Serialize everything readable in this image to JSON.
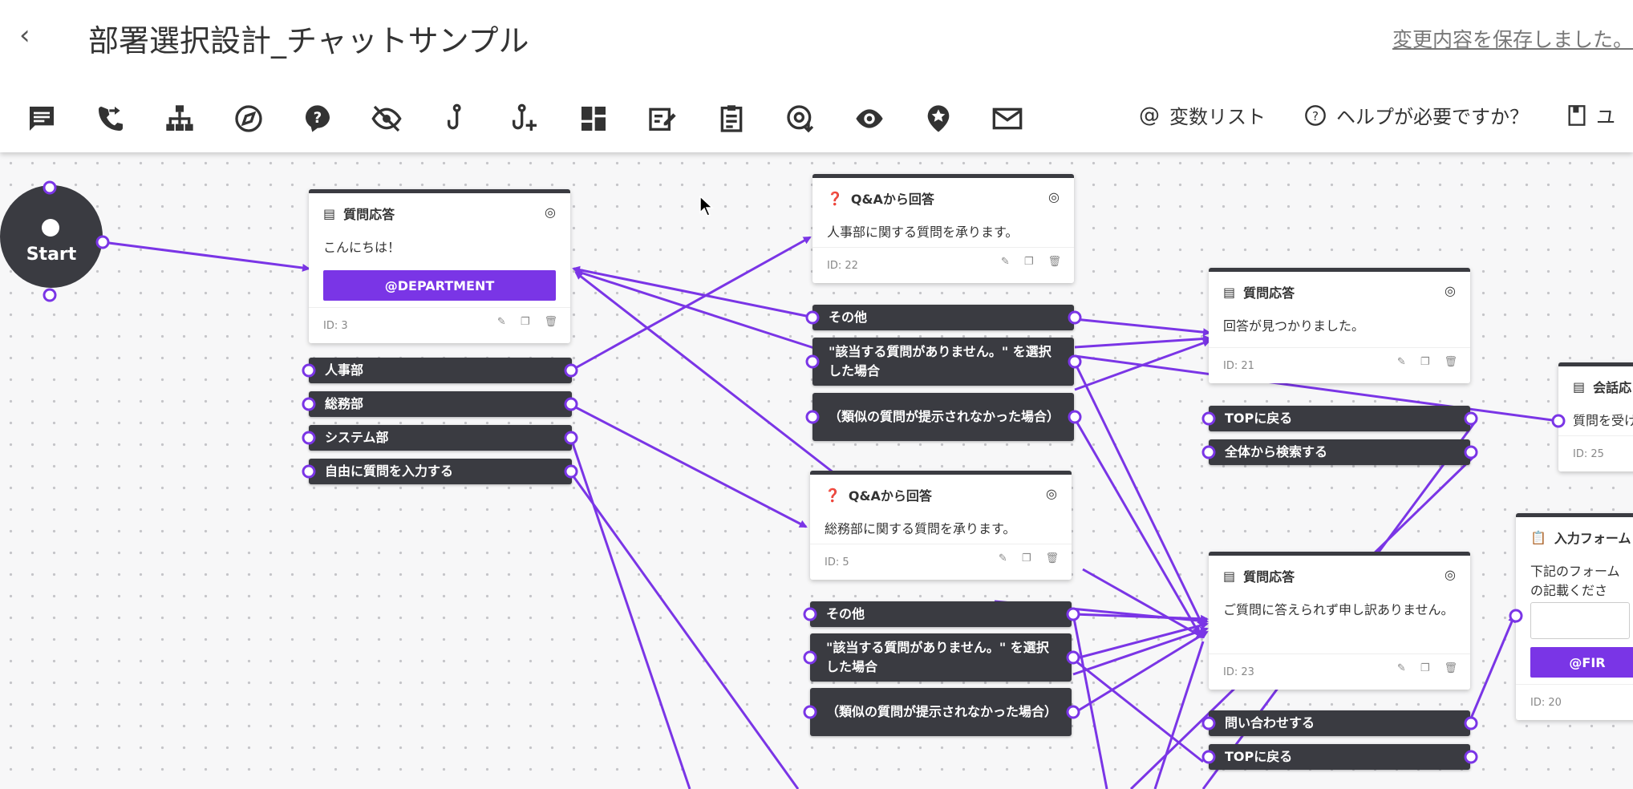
{
  "header": {
    "back_label": "‹",
    "title": "部署選択設計_チャットサンプル",
    "saved_status": "変更内容を保存しました。",
    "toolbar_icons": [
      "message-icon",
      "call-forward-icon",
      "hierarchy-icon",
      "compass-icon",
      "help-icon",
      "eye-off-icon",
      "hook-icon",
      "hook-plus-icon",
      "dashboard-icon",
      "edit-note-icon",
      "clipboard-icon",
      "at-download-icon",
      "eye-icon",
      "star-pin-icon",
      "mail-icon"
    ],
    "variables_label": "変数リスト",
    "help_label": "ヘルプが必要ですか？",
    "user_label": "ユ"
  },
  "flow": {
    "start_label": "Start",
    "card1": {
      "type": "質問応答",
      "message": "こんにちは！",
      "button": "@DEPARTMENT",
      "id": "ID: 3",
      "options": [
        "人事部",
        "総務部",
        "システム部",
        "自由に質問を入力する"
      ]
    },
    "card2": {
      "type": "Q&Aから回答",
      "message": "人事部に関する質問を承ります。",
      "id": "ID: 22",
      "options": [
        "その他",
        "\"該当する質問がありません。\" を選択した場合",
        "（類似の質問が提示されなかった場合）"
      ]
    },
    "card3": {
      "type": "Q&Aから回答",
      "message": "総務部に関する質問を承ります。",
      "id": "ID: 5",
      "options": [
        "その他",
        "\"該当する質問がありません。\" を選択した場合",
        "（類似の質問が提示されなかった場合）"
      ]
    },
    "card4": {
      "type": "質問応答",
      "message": "回答が見つかりました。",
      "id": "ID: 21",
      "options": [
        "TOPに戻る",
        "全体から検索する"
      ]
    },
    "card5": {
      "type": "質問応答",
      "message": "ご質問に答えられず申し訳ありません。",
      "id": "ID: 23",
      "options": [
        "問い合わせする",
        "TOPに戻る"
      ]
    },
    "card6": {
      "type": "会話応",
      "message": "質問を受け",
      "id": "ID: 25"
    },
    "card7": {
      "type": "入力フォーム",
      "message": "下記のフォームの記載ください。",
      "button": "@FIR",
      "id": "ID: 20"
    }
  },
  "colors": {
    "accent": "#7a35e6",
    "node_dark": "#3a3b41",
    "wire": "#7a35e6"
  }
}
